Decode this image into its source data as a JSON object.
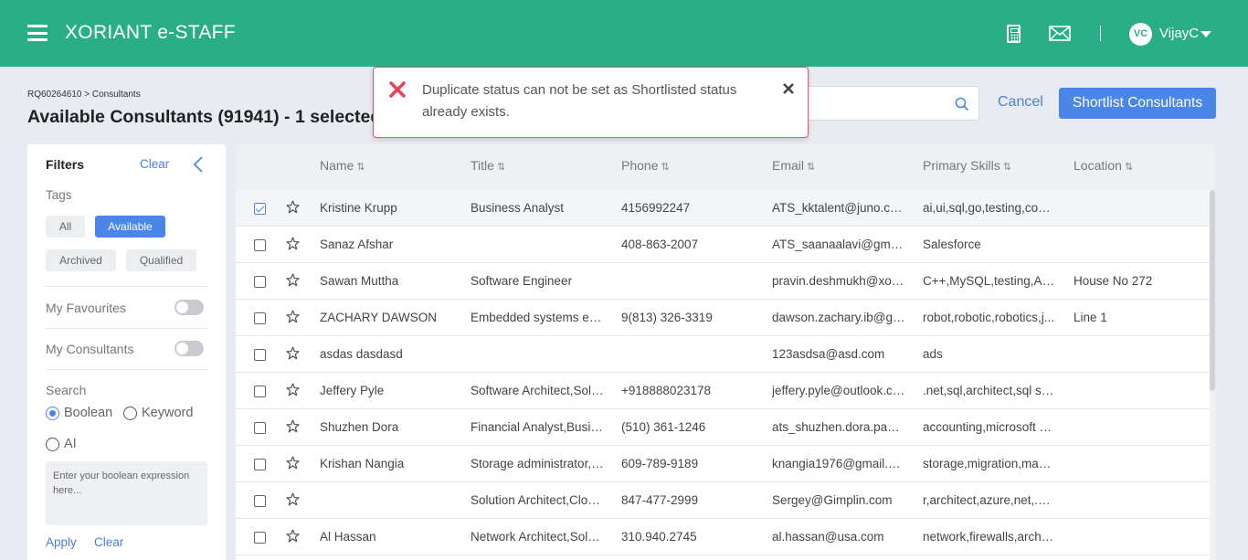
{
  "header": {
    "app_title": "XORIANT e-STAFF",
    "user_initials": "VC",
    "user_name": "VijayC",
    "brand_color": "#2aaf84",
    "icons": [
      "menu-icon",
      "calculator-icon",
      "mail-icon",
      "chevron-down-icon"
    ]
  },
  "page": {
    "breadcrumb": "RQ60264610 > Consultants",
    "title": "Available Consultants (91941) - 1 selected",
    "search_placeholder": "",
    "cancel_label": "Cancel",
    "shortlist_label": "Shortlist Consultants"
  },
  "toast": {
    "message": "Duplicate status can not be set as Shortlisted status already exists.",
    "type": "error",
    "accent_color": "#e8415e"
  },
  "filters": {
    "title": "Filters",
    "clear_label": "Clear",
    "tags_label": "Tags",
    "tags": [
      {
        "label": "All",
        "active": false
      },
      {
        "label": "Available",
        "active": true
      },
      {
        "label": "Archived",
        "active": false
      },
      {
        "label": "Qualified",
        "active": false
      }
    ],
    "my_favourites_label": "My Favourites",
    "my_favourites_on": false,
    "my_consultants_label": "My Consultants",
    "my_consultants_on": false,
    "search_label": "Search",
    "search_modes": [
      {
        "label": "Boolean",
        "checked": true
      },
      {
        "label": "Keyword",
        "checked": false
      },
      {
        "label": "AI",
        "checked": false
      }
    ],
    "boolean_placeholder": "Enter your boolean expression here...",
    "apply_label": "Apply",
    "clear2_label": "Clear"
  },
  "table": {
    "columns": [
      "Name",
      "Title",
      "Phone",
      "Email",
      "Primary Skills",
      "Location"
    ],
    "rows": [
      {
        "selected": true,
        "name": "Kristine Krupp",
        "title": "Business Analyst",
        "phone": "4156992247",
        "email": "ATS_kktalent@juno.com",
        "skills": "ai,ui,sql,go,testing,com...",
        "location": ""
      },
      {
        "selected": false,
        "name": "Sanaz Afshar",
        "title": "",
        "phone": "408-863-2007",
        "email": "ATS_saanaalavi@gmail....",
        "skills": "Salesforce",
        "location": ""
      },
      {
        "selected": false,
        "name": "Sawan Muttha",
        "title": "Software Engineer",
        "phone": "",
        "email": "pravin.deshmukh@xori...",
        "skills": "C++,MySQL,testing,Aut...",
        "location": "House No 272"
      },
      {
        "selected": false,
        "name": "ZACHARY DAWSON",
        "title": "Embedded systems eng...",
        "phone": "9(813) 326-3319",
        "email": "dawson.zachary.ib@gm...",
        "skills": "robot,robotic,robotics,j...",
        "location": "Line 1"
      },
      {
        "selected": false,
        "name": "asdas dasdasd",
        "title": "",
        "phone": "",
        "email": "123asdsa@asd.com",
        "skills": "ads",
        "location": ""
      },
      {
        "selected": false,
        "name": "Jeffery Pyle",
        "title": "Software Architect,Solu...",
        "phone": "+918888023178",
        "email": "jeffery.pyle@outlook.com",
        "skills": ".net,sql,architect,sql ser...",
        "location": ""
      },
      {
        "selected": false,
        "name": "Shuzhen Dora",
        "title": "Financial Analyst,Busin...",
        "phone": "(510) 361-1246",
        "email": "ats_shuzhen.dora.pan@...",
        "skills": "accounting,microsoft o...",
        "location": ""
      },
      {
        "selected": false,
        "name": "Krishan Nangia",
        "title": "Storage administrator,S...",
        "phone": "609-789-9189",
        "email": "knangia1976@gmail.com",
        "skills": "storage,migration,mana...",
        "location": ""
      },
      {
        "selected": false,
        "name": "",
        "title": "Solution Architect,Clou...",
        "phone": "847-477-2999",
        "email": "Sergey@Gimplin.com",
        "skills": "r,architect,azure,net,.ne...",
        "location": ""
      },
      {
        "selected": false,
        "name": "Al Hassan",
        "title": "Network Architect,Solu...",
        "phone": "310.940.2745",
        "email": "al.hassan@usa.com",
        "skills": "network,firewalls,archit...",
        "location": ""
      }
    ]
  }
}
